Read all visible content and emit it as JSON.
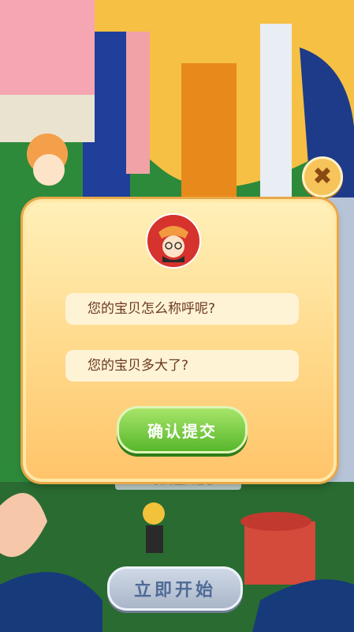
{
  "modal": {
    "name_placeholder": "您的宝贝怎么称呼呢?",
    "age_placeholder": "您的宝贝多大了?",
    "submit_label": "确认提交",
    "close_symbol": "✖"
  },
  "background": {
    "start_label": "立即开始",
    "hidden_label": "+ 我的宝贝信息"
  },
  "icons": {
    "close": "close-icon",
    "avatar": "cow-girl-avatar-icon"
  },
  "colors": {
    "modal_bg": "#ffd98a",
    "submit_green": "#57b72b",
    "start_blue": "#4f6a96",
    "close_gold": "#f6c45a"
  }
}
